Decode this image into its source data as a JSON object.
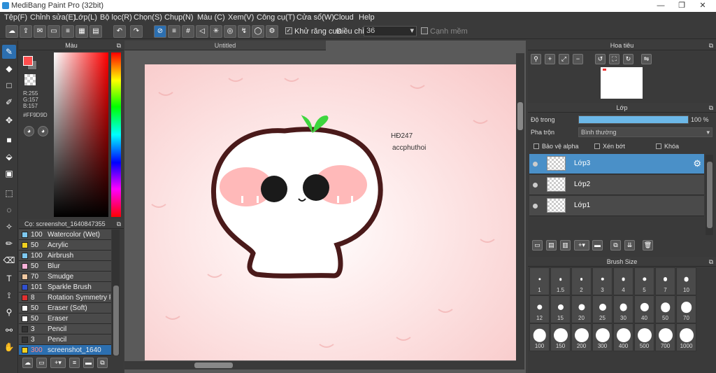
{
  "title": "MediBang Paint Pro (32bit)",
  "menu": [
    "Tệp(F)",
    "Chỉnh sửa(E)",
    "Lớp(L)",
    "Bộ lọc(R)",
    "Chọn(S)",
    "Chụp(N)",
    "Màu (C)",
    "Xem(V)",
    "Công cụ(T)",
    "Cửa sổ(W)",
    "Cloud",
    "Help"
  ],
  "toolbar": {
    "antialias": "Khử răng cưa",
    "adjust": "Điều chỉnh",
    "adjust_value": "36",
    "edge": "Cạnh mềm"
  },
  "color_panel": {
    "title": "Màu",
    "r": "R:255",
    "g": "G:157",
    "b": "B:157",
    "hex": "#FF9D9D",
    "fg": "#ff4d4d"
  },
  "brush_panel": {
    "title": "Cọ: screenshot_1640847355",
    "items": [
      {
        "size": "100",
        "name": "Watercolor (Wet)",
        "color": "#7ec8f0"
      },
      {
        "size": "50",
        "name": "Acrylic",
        "color": "#f0d020"
      },
      {
        "size": "100",
        "name": "Airbrush",
        "color": "#7ec8f0"
      },
      {
        "size": "50",
        "name": "Blur",
        "color": "#f8b0d8"
      },
      {
        "size": "70",
        "name": "Smudge",
        "color": "#f0c8a0"
      },
      {
        "size": "101",
        "name": "Sparkle Brush",
        "color": "#3050d0"
      },
      {
        "size": "8",
        "name": "Rotation Symmetry Pe",
        "color": "#e03030"
      },
      {
        "size": "50",
        "name": "Eraser (Soft)",
        "color": "#ffffff"
      },
      {
        "size": "50",
        "name": "Eraser",
        "color": "#ffffff"
      },
      {
        "size": "3",
        "name": "Pencil",
        "color": "#333333"
      },
      {
        "size": "3",
        "name": "Pencil",
        "color": "#333333"
      },
      {
        "size": "300",
        "name": "screenshot_1640",
        "color": "#f0d020"
      }
    ]
  },
  "canvas": {
    "tab": "Untitled",
    "watermark1": "HĐ247",
    "watermark2": "accphuthoi"
  },
  "navigator": {
    "title": "Hoa tiêu"
  },
  "layers": {
    "title": "Lớp",
    "opacity_label": "Độ trong",
    "opacity_value": "100 %",
    "opacity": 1.0,
    "blend_label": "Pha trộn",
    "blend_value": "Bình thường",
    "protect_alpha": "Bảo vệ alpha",
    "clipping": "Xén bớt",
    "lock": "Khóa",
    "items": [
      "Lớp3",
      "Lớp2",
      "Lớp1"
    ]
  },
  "brush_size": {
    "title": "Brush Size",
    "sizes": [
      "1",
      "1.5",
      "2",
      "3",
      "4",
      "5",
      "7",
      "10",
      "12",
      "15",
      "20",
      "25",
      "30",
      "40",
      "50",
      "70",
      "100",
      "150",
      "200",
      "300",
      "400",
      "500",
      "700",
      "1000"
    ]
  }
}
